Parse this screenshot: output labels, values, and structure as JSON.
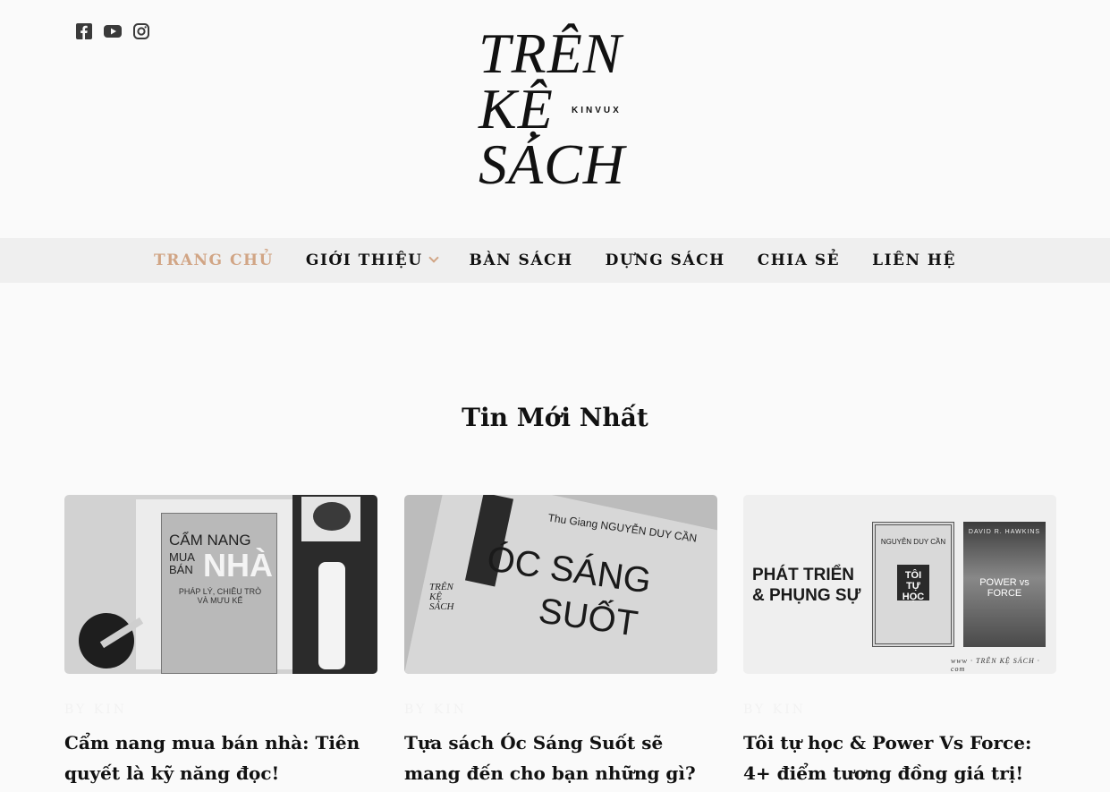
{
  "colors": {
    "accent": "#d1a585",
    "nav_bg": "#efefef",
    "page_bg": "#fafafa",
    "text": "#111111"
  },
  "social": [
    {
      "icon": "facebook-icon"
    },
    {
      "icon": "youtube-icon"
    },
    {
      "icon": "instagram-icon"
    }
  ],
  "logo": {
    "line1": "TRÊN",
    "line2": "KỆ",
    "line3": "SÁCH",
    "sub": "KINVUX"
  },
  "nav": {
    "items": [
      {
        "label": "TRANG CHỦ",
        "active": true
      },
      {
        "label": "GIỚI THIỆU",
        "has_dropdown": true
      },
      {
        "label": "BÀN SÁCH"
      },
      {
        "label": "DỰNG SÁCH"
      },
      {
        "label": "CHIA SẺ"
      },
      {
        "label": "LIÊN HỆ"
      }
    ]
  },
  "section": {
    "title": "Tin Mới Nhất"
  },
  "posts": [
    {
      "by": "BY KIN",
      "title": "Cẩm nang mua bán nhà: Tiên quyết là kỹ năng đọc!",
      "image": {
        "book_title": "CẨM NANG",
        "book_line2": "MUA",
        "book_line3": "BÁN",
        "book_big": "NHÀ",
        "book_sub": "PHÁP LÝ, CHIÊU TRÒ VÀ MƯU KẾ"
      }
    },
    {
      "by": "BY KIN",
      "title": "Tựa sách Óc Sáng Suốt sẽ mang đến cho bạn những gì?",
      "image": {
        "author": "Thu Giang NGUYỄN DUY CẦN",
        "big1": "ÓC SÁNG",
        "big2": "SUỐT",
        "stamp": "TRÊN KỆ SÁCH"
      }
    },
    {
      "by": "BY KIN",
      "title": "Tôi tự học & Power Vs Force: 4+ điểm tương đồng giá trị!",
      "image": {
        "headline1": "PHÁT TRIỂN",
        "headline2": "& PHỤNG SỰ",
        "book1_author": "NGUYỄN DUY CẦN",
        "book1_title": "TÔI TỰ HỌC",
        "book2_author": "DAVID R. HAWKINS",
        "book2_title": "POWER vs FORCE",
        "site": "www · TRÊN KỆ SÁCH · com"
      }
    }
  ]
}
